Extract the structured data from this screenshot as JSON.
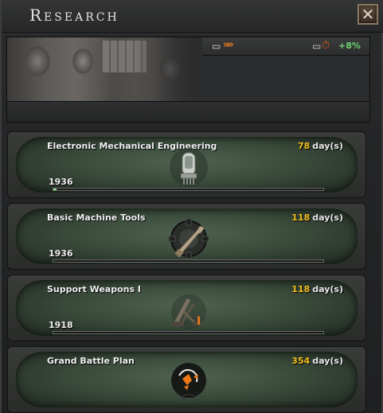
{
  "window": {
    "title": "Research",
    "close_symbol": "✕"
  },
  "header": {
    "speed_icon": "research-speed-icon",
    "bonus_icon": "research-bonus-icon",
    "bonus_value": "+8%"
  },
  "slots": [
    {
      "name": "Electronic Mechanical Engineering",
      "days": "78",
      "days_unit": "day(s)",
      "year": "1936",
      "progress": 0.01,
      "icon": "vacuum-tube-icon"
    },
    {
      "name": "Basic Machine Tools",
      "days": "118",
      "days_unit": "day(s)",
      "year": "1936",
      "progress": 0,
      "icon": "wrench-gear-icon"
    },
    {
      "name": "Support Weapons I",
      "days": "118",
      "days_unit": "day(s)",
      "year": "1918",
      "progress": 0,
      "icon": "mortar-icon"
    },
    {
      "name": "Grand Battle Plan",
      "days": "354",
      "days_unit": "day(s)",
      "year": "",
      "progress": 0,
      "icon": "battle-plan-icon"
    }
  ],
  "colors": {
    "days_number": "#f0c020",
    "bonus": "#6fd36f",
    "speed_arrows": "#e07a1e",
    "progress_fill": "#8fe08f"
  }
}
